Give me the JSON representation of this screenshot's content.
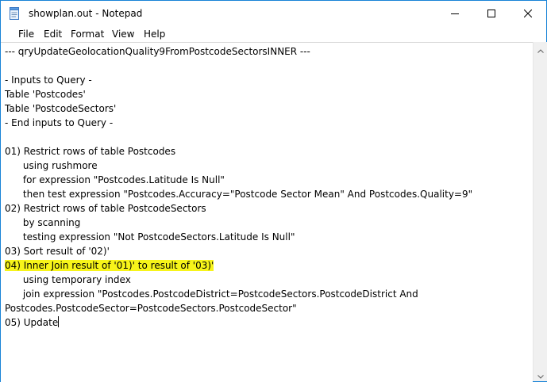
{
  "window": {
    "title": "showplan.out - Notepad",
    "icon": "notepad-icon"
  },
  "caption_buttons": {
    "minimize": "minimize-icon",
    "maximize": "maximize-icon",
    "close": "close-icon"
  },
  "menu": {
    "items": [
      "File",
      "Edit",
      "Format",
      "View",
      "Help"
    ]
  },
  "editor": {
    "lines": [
      "--- qryUpdateGeolocationQuality9FromPostcodeSectorsINNER ---",
      "",
      "- Inputs to Query -",
      "Table 'Postcodes'",
      "Table 'PostcodeSectors'",
      "- End inputs to Query -",
      "",
      "01) Restrict rows of table Postcodes",
      "      using rushmore",
      "      for expression \"Postcodes.Latitude Is Null\"",
      "      then test expression \"Postcodes.Accuracy=\"Postcode Sector Mean\" And Postcodes.Quality=9\"",
      "02) Restrict rows of table PostcodeSectors",
      "      by scanning",
      "      testing expression \"Not PostcodeSectors.Latitude Is Null\"",
      "03) Sort result of '02)'",
      "04) Inner Join result of '01)' to result of '03)'",
      "      using temporary index",
      "      join expression \"Postcodes.PostcodeDistrict=PostcodeSectors.PostcodeDistrict And",
      "Postcodes.PostcodeSector=PostcodeSectors.PostcodeSector\"",
      "05) Update"
    ],
    "highlight_color": "#f7f41a"
  }
}
